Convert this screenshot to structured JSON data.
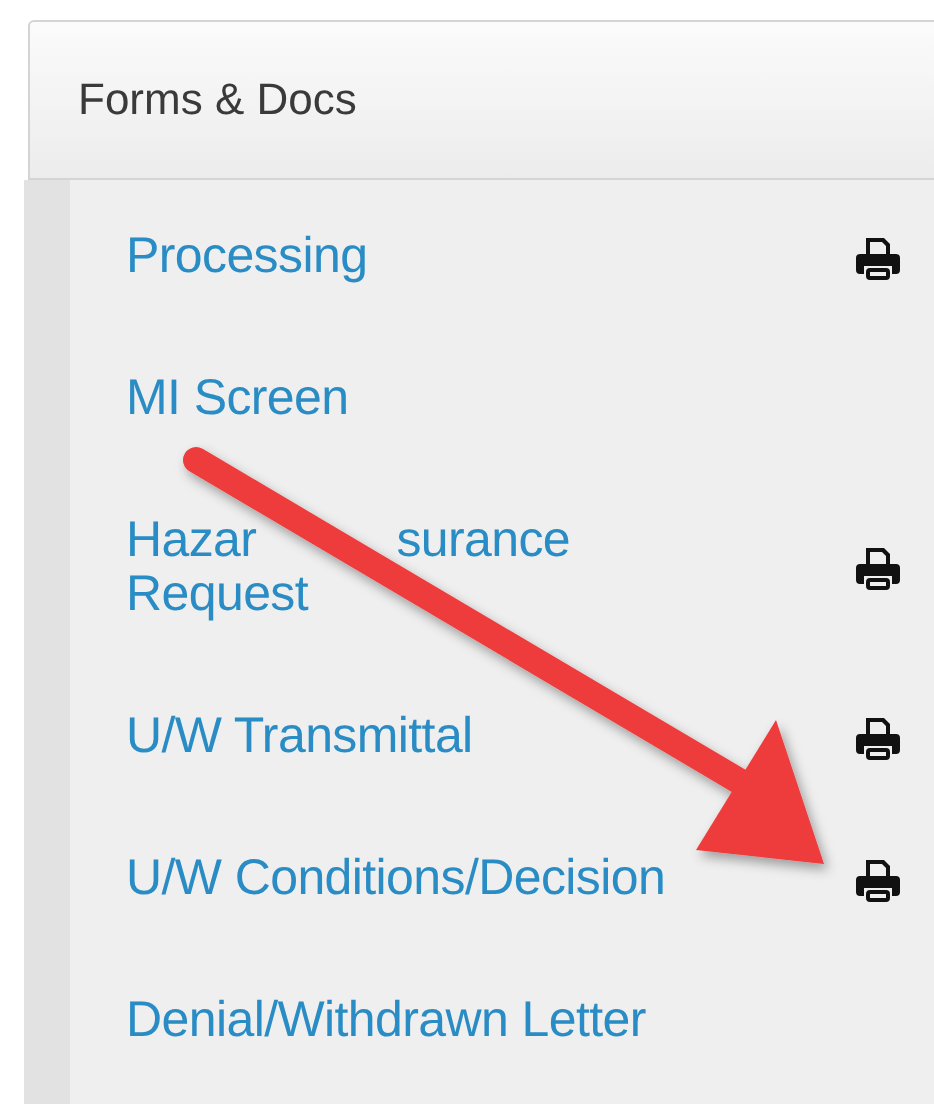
{
  "panel": {
    "title": "Forms & Docs"
  },
  "items": [
    {
      "lines": [
        [
          "Processing"
        ]
      ],
      "printable": true
    },
    {
      "lines": [
        [
          "MI Screen"
        ]
      ],
      "printable": false
    },
    {
      "lines": [
        [
          "Hazar",
          "surance"
        ],
        [
          "Request"
        ]
      ],
      "printable": true
    },
    {
      "lines": [
        [
          "U/W Transmittal"
        ]
      ],
      "printable": true
    },
    {
      "lines": [
        [
          "U/W Conditions/Decision"
        ]
      ],
      "printable": true
    },
    {
      "lines": [
        [
          "Denial/Withdrawn Letter"
        ]
      ],
      "printable": false
    }
  ]
}
